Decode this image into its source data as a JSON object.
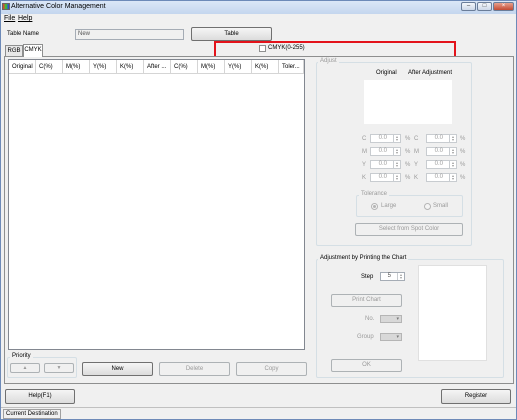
{
  "window": {
    "title": "Alternative Color Management",
    "minimize": "–",
    "maximize": "□",
    "close": "×"
  },
  "menu": {
    "file": "File",
    "help": "Help"
  },
  "table_name": {
    "label": "Table Name",
    "value": "New"
  },
  "table_button": "Table",
  "cmyk_checkbox": {
    "label": "CMYK(0-255)",
    "checked": false
  },
  "tabs": [
    {
      "label": "RGB",
      "active": false
    },
    {
      "label": "CMYK",
      "active": true
    }
  ],
  "list": {
    "columns": [
      "Original",
      "C(%)",
      "M(%)",
      "Y(%)",
      "K(%)",
      "After ...",
      "C(%)",
      "M(%)",
      "Y(%)",
      "K(%)",
      "Toler..."
    ],
    "rows": []
  },
  "priority": {
    "label": "Priority",
    "up": "▲",
    "down": "▼"
  },
  "list_buttons": {
    "new": "New",
    "delete": "Delete",
    "copy": "Copy"
  },
  "adjust": {
    "label": "Adjust",
    "original_header": "Original",
    "after_header": "After Adjustment",
    "rows": [
      {
        "label": "C",
        "original": "0.0",
        "after": "0.0"
      },
      {
        "label": "M",
        "original": "0.0",
        "after": "0.0"
      },
      {
        "label": "Y",
        "original": "0.0",
        "after": "0.0"
      },
      {
        "label": "K",
        "original": "0.0",
        "after": "0.0"
      }
    ],
    "unit": "%",
    "tolerance": {
      "label": "Tolerance",
      "large": "Large",
      "small": "Small",
      "selected": "Large"
    },
    "spot_button": "Select from Spot Color"
  },
  "printing": {
    "label": "Adjustment by Printing the Chart",
    "step_label": "Step",
    "step_value": "5",
    "print_button": "Print Chart",
    "no_label": "No.",
    "group_label": "Group",
    "ok_button": "OK"
  },
  "footer": {
    "help": "Help(F1)",
    "register": "Register"
  },
  "status": {
    "current_destination": "Current Destination"
  },
  "colors": {
    "highlight": "#e3131b",
    "title_bar": "#c4d6ee"
  },
  "icons": {
    "app": "color-management-icon",
    "spin": "spin-arrows-icon",
    "combo": "chevron-down-icon"
  }
}
